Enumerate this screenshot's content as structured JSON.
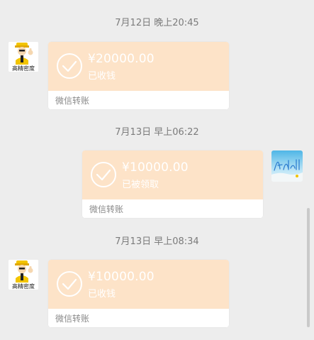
{
  "messages": [
    {
      "timestamp": "7月12日 晚上20:45",
      "sender": "left",
      "amount": "¥20000.00",
      "status": "已收钱",
      "footer": "微信转账"
    },
    {
      "timestamp": "7月13日 早上06:22",
      "sender": "right",
      "amount": "¥10000.00",
      "status": "已被领取",
      "footer": "微信转账"
    },
    {
      "timestamp": "7月13日 早上08:34",
      "sender": "left",
      "amount": "¥10000.00",
      "status": "已收钱",
      "footer": "微信转账"
    }
  ],
  "contact_avatar": {
    "label": "高精密度",
    "icon": "cartoon-worker-thumbs-up"
  },
  "self_avatar": {
    "icon": "sky-handwriting-avatar"
  },
  "colors": {
    "background": "#ededed",
    "card_top": "#fde3c8",
    "card_text": "#ffffff",
    "footer_text": "#8a8a8a",
    "timestamp_text": "#7b7b7b"
  }
}
